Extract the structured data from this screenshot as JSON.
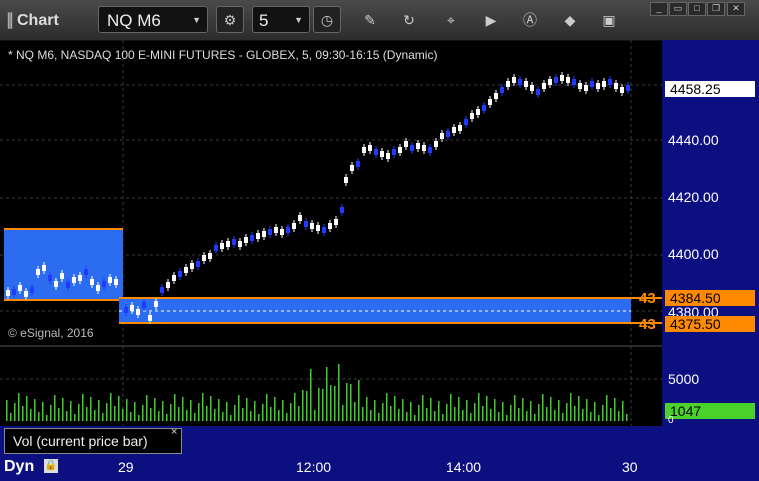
{
  "toolbar": {
    "title": "Chart",
    "symbol": "NQ M6",
    "interval": "5"
  },
  "chart": {
    "info": "* NQ M6, NASDAQ 100 E-MINI FUTURES - GLOBEX, 5, 09:30-16:15 (Dynamic)",
    "copyright": "© eSignal, 2016",
    "price_labels": [
      "4440.00",
      "4420.00",
      "4400.00",
      "4380.00"
    ],
    "last_price": "4458.25",
    "level_high": "4384.50",
    "level_low": "4375.50",
    "level_tag": "43",
    "vol_label": "5000",
    "vol_last": "1047",
    "vol_zero": "0",
    "vol_tab": "Vol (current price bar)",
    "vol_close": "×",
    "x_labels": [
      "29",
      "12:00",
      "14:00",
      "30"
    ],
    "dyn": "Dyn"
  },
  "colors": {
    "up": "#ffffff",
    "down": "#1e3cff",
    "band": "#2b6cf0",
    "band_edge": "#ff8a00",
    "axis_bg": "#0b0f80",
    "vol_up": "#3ecf2a",
    "vol_down": "#d21f1f"
  },
  "icons": [
    "gear-icon",
    "pencil-icon",
    "refresh-icon",
    "play-icon",
    "alert-icon",
    "eraser-icon",
    "snapshot-icon",
    "dropdown-icon"
  ]
}
